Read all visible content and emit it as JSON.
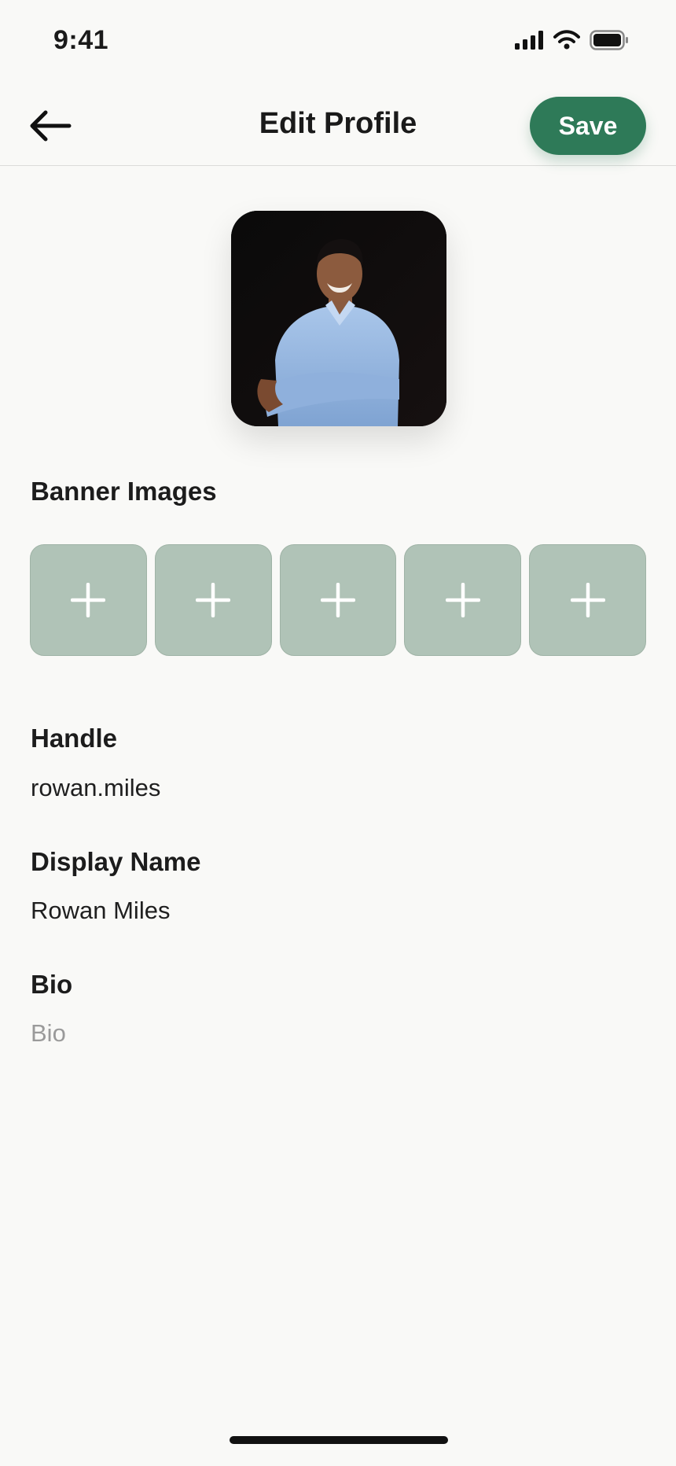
{
  "status_bar": {
    "time": "9:41",
    "icons": [
      "cellular-signal-icon",
      "wifi-icon",
      "battery-icon"
    ]
  },
  "nav": {
    "back_icon": "arrow-left-icon",
    "title": "Edit Profile",
    "save_label": "Save"
  },
  "profile": {
    "avatar_alt": "Profile photo"
  },
  "banner": {
    "label": "Banner Images",
    "slots": [
      "plus-icon",
      "plus-icon",
      "plus-icon",
      "plus-icon",
      "plus-icon"
    ]
  },
  "fields": {
    "handle": {
      "label": "Handle",
      "value": "rowan.miles"
    },
    "display_name": {
      "label": "Display Name",
      "value": "Rowan Miles"
    },
    "bio": {
      "label": "Bio",
      "value": "",
      "placeholder": "Bio"
    }
  },
  "colors": {
    "accent": "#2e7a58",
    "banner_slot": "#b0c3b7",
    "background": "#f9f9f7"
  }
}
